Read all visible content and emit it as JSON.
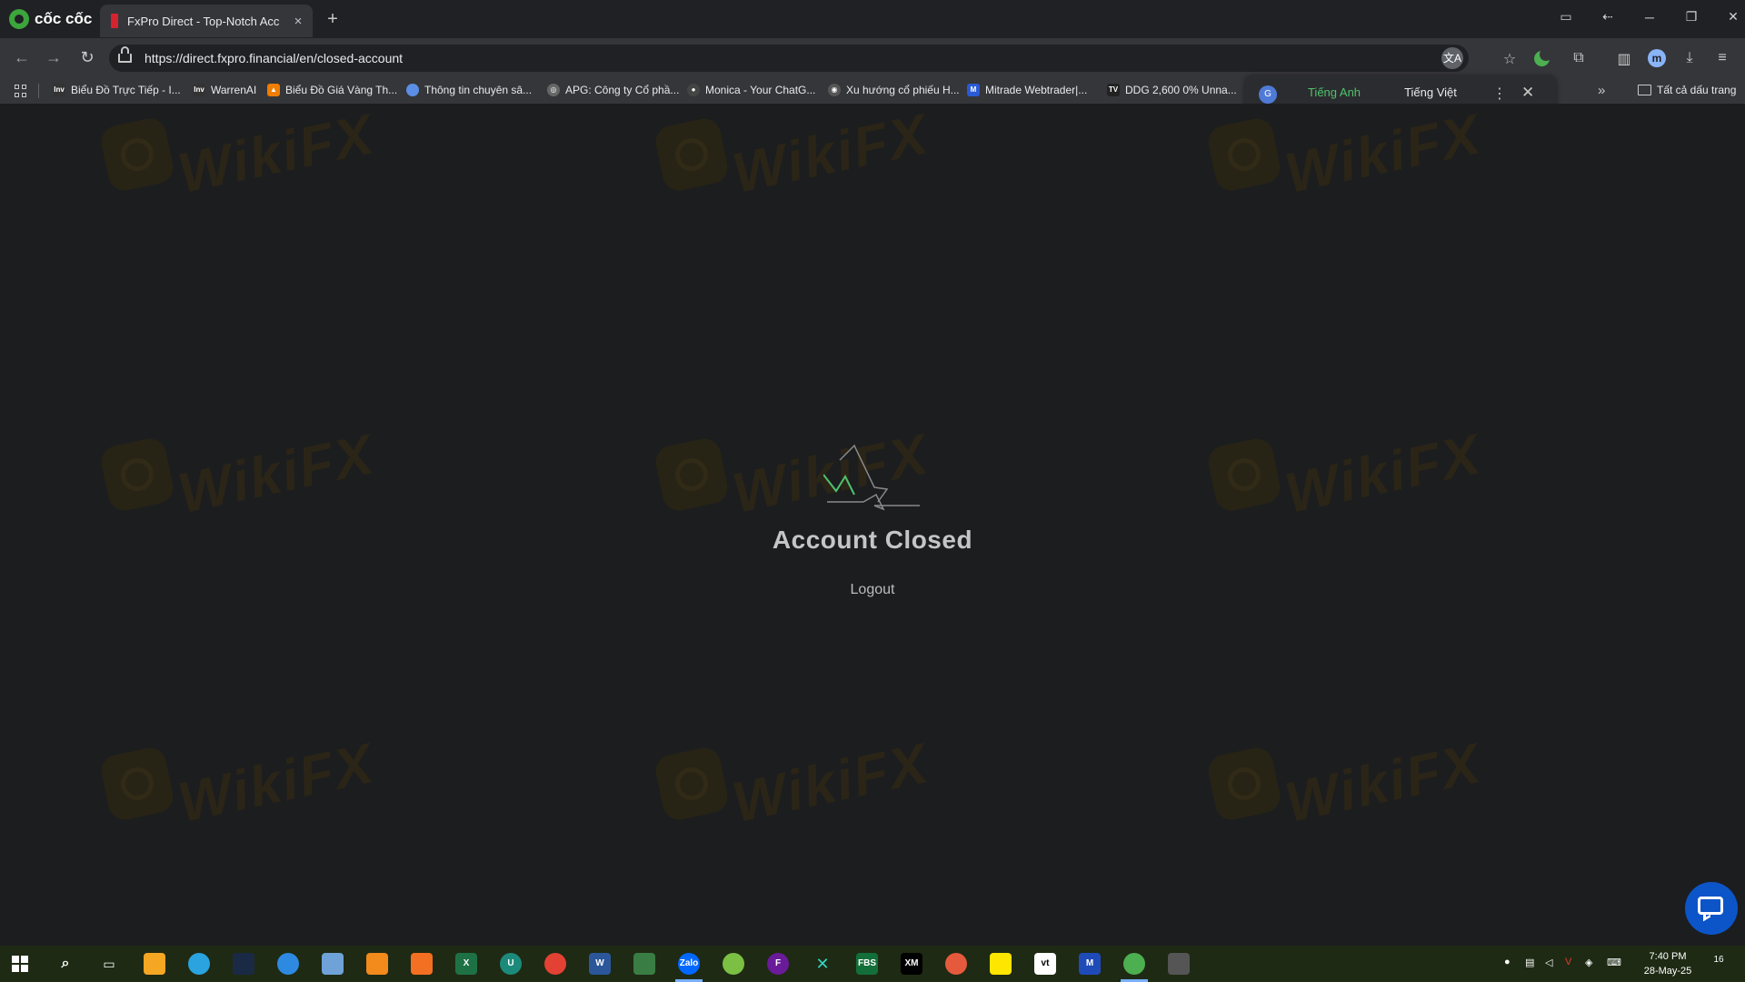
{
  "browser": {
    "brand": "cốc cốc",
    "tab_title": "FxPro Direct - Top-Notch Acc",
    "tab_close": "×",
    "new_tab": "+",
    "url": "https://direct.fxpro.financial/en/closed-account",
    "profile_initial": "m",
    "translate_glyph": "文A"
  },
  "bookmarks": [
    {
      "label": "Biểu Đồ Trực Tiếp - I...",
      "icon": "inv",
      "color": "#333333"
    },
    {
      "label": "WarrenAI",
      "icon": "inv",
      "color": "#333333"
    },
    {
      "label": "Biểu Đồ Giá Vàng Th...",
      "icon": "orange",
      "color": "#f07d00"
    },
    {
      "label": "Thông tin chuyên sâ...",
      "icon": "bubble",
      "color": "#5b8ee6"
    },
    {
      "label": "APG: Công ty Cổ phầ...",
      "icon": "globe",
      "color": "#666666"
    },
    {
      "label": "Monica - Your ChatG...",
      "icon": "monica",
      "color": "#444444"
    },
    {
      "label": "Xu hướng cổ phiếu H...",
      "icon": "circle",
      "color": "#555555"
    },
    {
      "label": "Mitrade Webtrader|...",
      "icon": "mitrade",
      "color": "#2a5bd7"
    },
    {
      "label": "DDG 2,600 0% Unna...",
      "icon": "tv",
      "color": "#222222"
    }
  ],
  "bookmarks_all": "Tất cả dấu trang",
  "bookmarks_more": "»",
  "translate": {
    "tab_source": "Tiếng Anh",
    "tab_target": "Tiếng Việt",
    "menu": "⋮",
    "close": "✕",
    "g_label": "G"
  },
  "page": {
    "watermark_text": "WikiFX",
    "title": "Account Closed",
    "logout": "Logout",
    "accent_green": "#4fc36b"
  },
  "taskbar": {
    "time": "7:40 PM",
    "date": "28-May-25",
    "notifications": "16"
  }
}
